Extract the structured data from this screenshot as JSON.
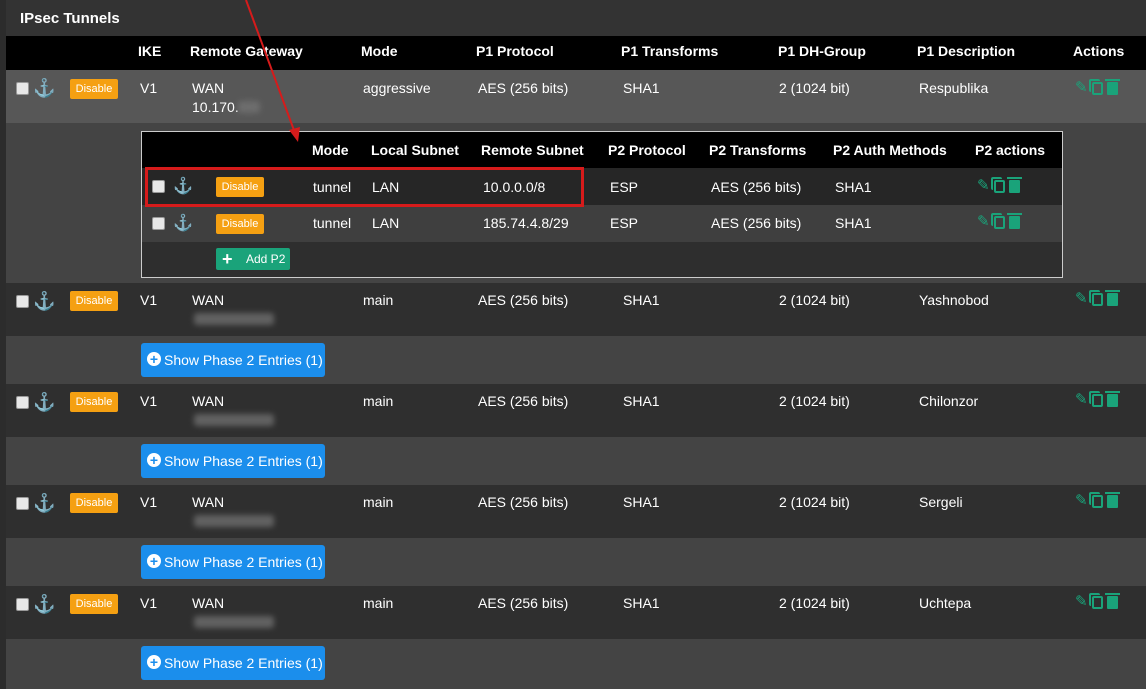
{
  "panel_title": "IPsec Tunnels",
  "columns": [
    "IKE",
    "Remote Gateway",
    "Mode",
    "P1 Protocol",
    "P1 Transforms",
    "P1 DH-Group",
    "P1 Description",
    "Actions"
  ],
  "disable_label": "Disable",
  "tunnels": [
    {
      "ike": "V1",
      "gw": "WAN",
      "gw_ip": "10.170.",
      "mode": "aggressive",
      "proto": "AES (256 bits)",
      "transforms": "SHA1",
      "dh": "2 (1024 bit)",
      "desc": "Respublika"
    },
    {
      "ike": "V1",
      "gw": "WAN",
      "gw_ip": "",
      "mode": "main",
      "proto": "AES (256 bits)",
      "transforms": "SHA1",
      "dh": "2 (1024 bit)",
      "desc": "Yashnobod"
    },
    {
      "ike": "V1",
      "gw": "WAN",
      "gw_ip": "",
      "mode": "main",
      "proto": "AES (256 bits)",
      "transforms": "SHA1",
      "dh": "2 (1024 bit)",
      "desc": "Chilonzor"
    },
    {
      "ike": "V1",
      "gw": "WAN",
      "gw_ip": "",
      "mode": "main",
      "proto": "AES (256 bits)",
      "transforms": "SHA1",
      "dh": "2 (1024 bit)",
      "desc": "Sergeli"
    },
    {
      "ike": "V1",
      "gw": "WAN",
      "gw_ip": "",
      "mode": "main",
      "proto": "AES (256 bits)",
      "transforms": "SHA1",
      "dh": "2 (1024 bit)",
      "desc": "Uchtepa"
    }
  ],
  "p2_columns": [
    "Mode",
    "Local Subnet",
    "Remote Subnet",
    "P2 Protocol",
    "P2 Transforms",
    "P2 Auth Methods",
    "P2 actions"
  ],
  "p2_entries": [
    {
      "mode": "tunnel",
      "local": "LAN",
      "remote": "10.0.0.0/8",
      "proto": "ESP",
      "transforms": "AES (256 bits)",
      "auth": "SHA1"
    },
    {
      "mode": "tunnel",
      "local": "LAN",
      "remote": "185.74.4.8/29",
      "proto": "ESP",
      "transforms": "AES (256 bits)",
      "auth": "SHA1"
    }
  ],
  "add_p2_label": "Add P2",
  "show_phase2_label": "Show Phase 2 Entries (1)",
  "colors": {
    "accent": "#1aa37a",
    "disable": "#f5a012",
    "show_btn": "#1b8eec",
    "highlight": "#d61b1b"
  }
}
